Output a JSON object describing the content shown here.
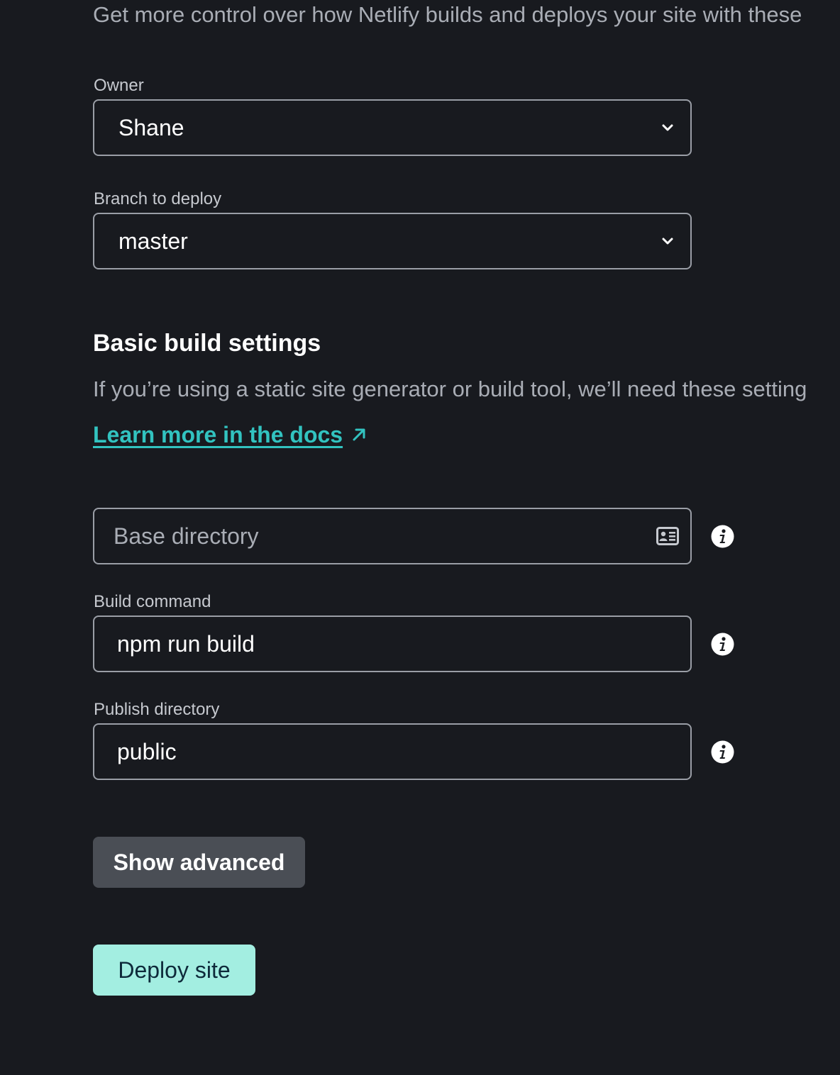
{
  "intro_text": "Get more control over how Netlify builds and deploys your site with these",
  "owner": {
    "label": "Owner",
    "selected": "Shane"
  },
  "branch": {
    "label": "Branch to deploy",
    "selected": "master"
  },
  "build_settings": {
    "heading": "Basic build settings",
    "description": "If you’re using a static site generator or build tool, we’ll need these setting",
    "docs_link": "Learn more in the docs",
    "docs_link_icon": "external-arrow-icon"
  },
  "base_directory": {
    "placeholder": "Base directory",
    "value": "",
    "icon": "contact-card-icon"
  },
  "build_command": {
    "label": "Build command",
    "value": "npm run build"
  },
  "publish_directory": {
    "label": "Publish directory",
    "value": "public"
  },
  "buttons": {
    "show_advanced": "Show advanced",
    "deploy": "Deploy site"
  },
  "colors": {
    "background": "#181a1f",
    "link": "#32c3c0",
    "deploy_button": "#a3eee1",
    "secondary_button": "#4a4e55"
  }
}
